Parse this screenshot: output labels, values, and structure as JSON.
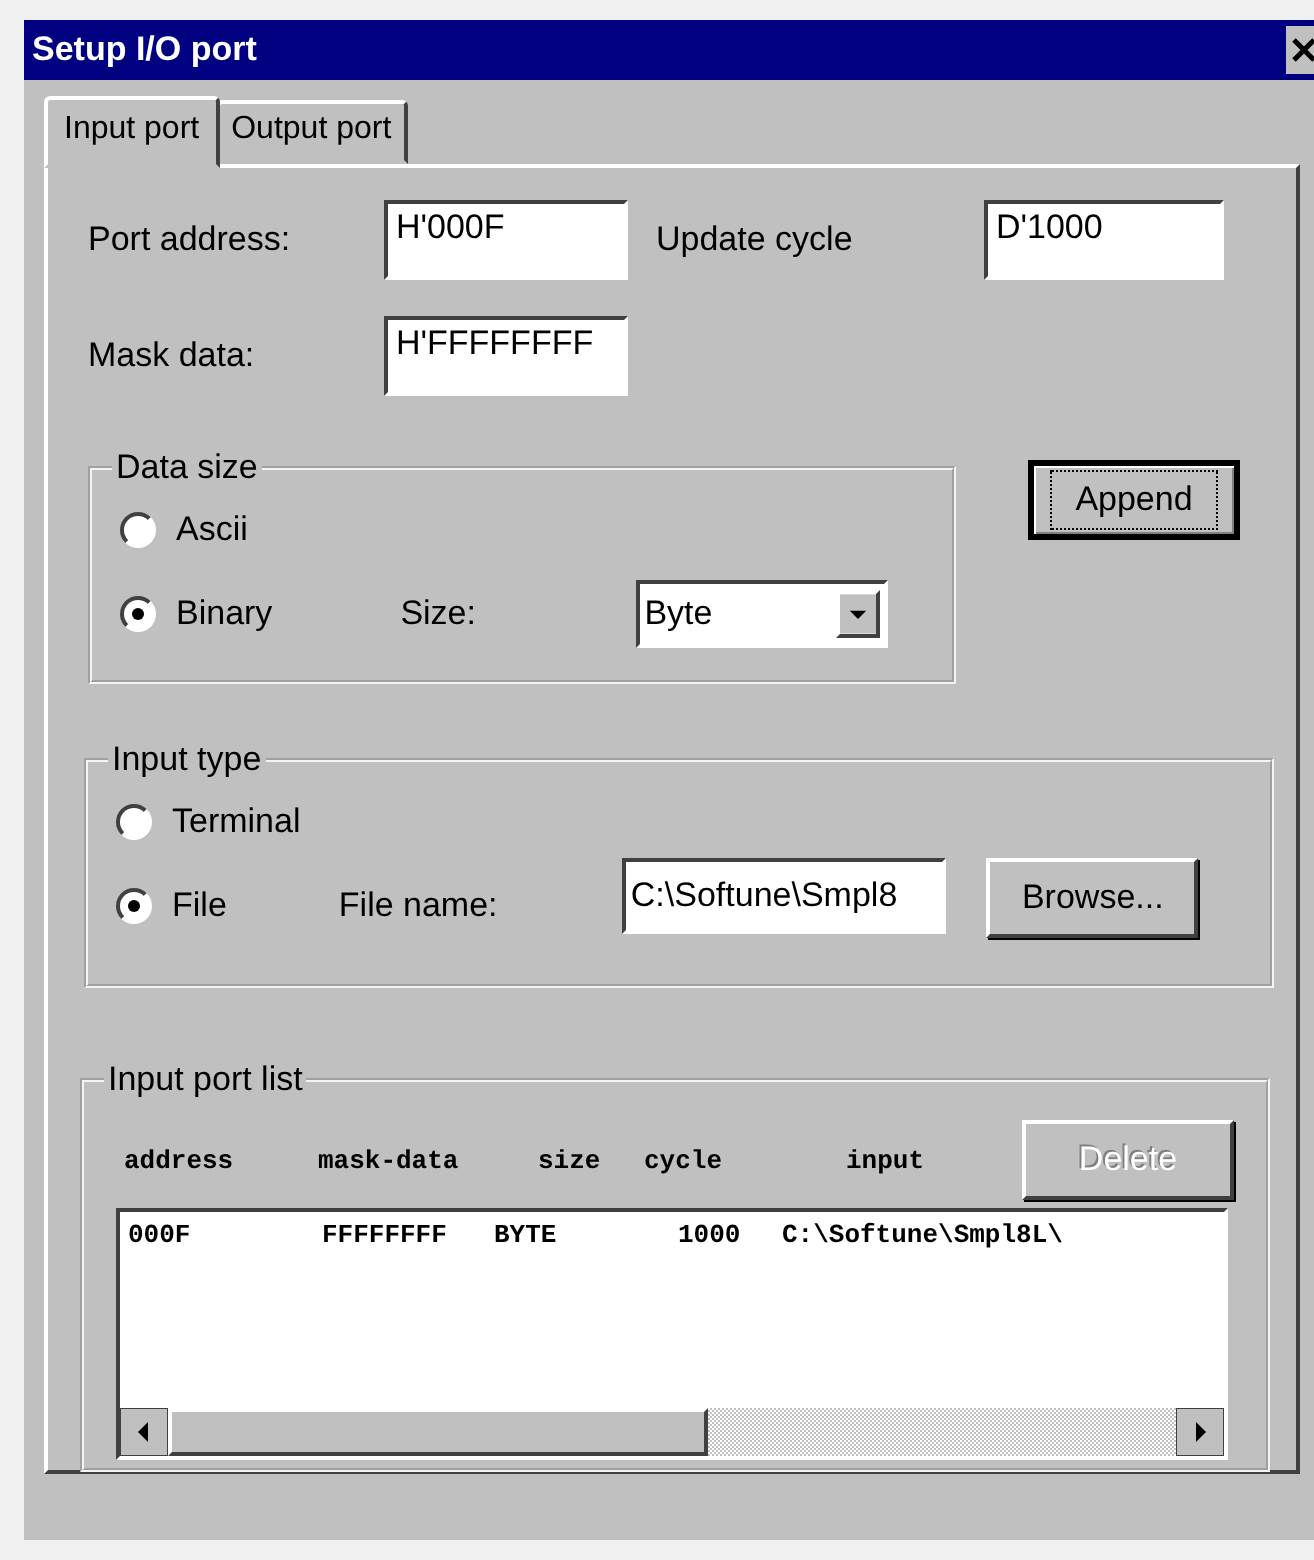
{
  "window": {
    "title": "Setup I/O port"
  },
  "tabs": [
    {
      "label": "Input port",
      "selected": true
    },
    {
      "label": "Output port",
      "selected": false
    }
  ],
  "port_address": {
    "label": "Port address:",
    "value": "H'000F"
  },
  "update_cycle": {
    "label": "Update cycle",
    "value": "D'1000"
  },
  "mask_data": {
    "label": "Mask data:",
    "value": "H'FFFFFFFF"
  },
  "data_size": {
    "title": "Data size",
    "options": [
      {
        "label": "Ascii",
        "selected": false
      },
      {
        "label": "Binary",
        "selected": true
      }
    ],
    "size": {
      "label": "Size:",
      "value": "Byte"
    }
  },
  "append_button": {
    "label": "Append",
    "disabled": false
  },
  "input_type": {
    "title": "Input type",
    "options": [
      {
        "label": "Terminal",
        "selected": false
      },
      {
        "label": "File",
        "selected": true
      }
    ],
    "file_name": {
      "label": "File name:",
      "value": "C:\\Softune\\Smpl8"
    },
    "browse_button": {
      "label": "Browse...",
      "disabled": false
    }
  },
  "input_port_list": {
    "title": "Input port list",
    "columns": [
      "address",
      "mask-data",
      "size",
      "cycle",
      "input"
    ],
    "delete_button": {
      "label": "Delete",
      "disabled": true
    },
    "rows": [
      {
        "address": "000F",
        "mask_data": "FFFFFFFF",
        "size": "BYTE",
        "cycle": "1000",
        "input": "C:\\Softune\\Smpl8L\\"
      }
    ]
  }
}
